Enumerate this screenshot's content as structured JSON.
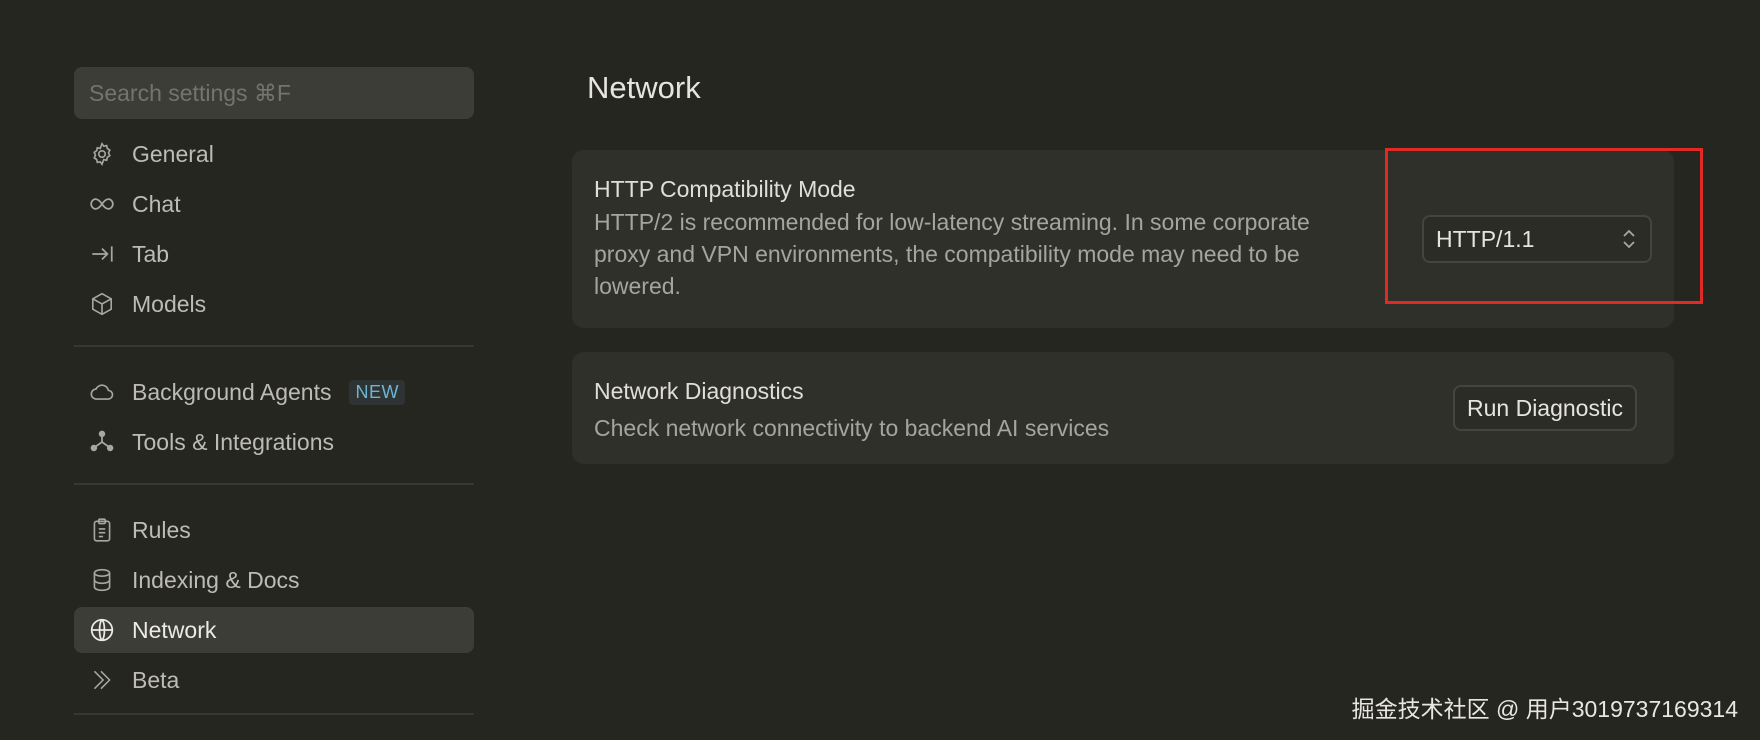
{
  "search": {
    "placeholder": "Search settings ⌘F"
  },
  "sidebar": {
    "groups": [
      [
        {
          "label": "General",
          "icon": "gear-icon"
        },
        {
          "label": "Chat",
          "icon": "infinity-icon"
        },
        {
          "label": "Tab",
          "icon": "arrow-right-bar-icon"
        },
        {
          "label": "Models",
          "icon": "cube-icon"
        }
      ],
      [
        {
          "label": "Background Agents",
          "icon": "cloud-icon",
          "badge": "NEW"
        },
        {
          "label": "Tools & Integrations",
          "icon": "nodes-icon"
        }
      ],
      [
        {
          "label": "Rules",
          "icon": "clipboard-icon"
        },
        {
          "label": "Indexing & Docs",
          "icon": "database-icon"
        },
        {
          "label": "Network",
          "icon": "globe-icon",
          "active": true
        },
        {
          "label": "Beta",
          "icon": "double-chevron-icon"
        }
      ]
    ]
  },
  "main": {
    "title": "Network",
    "http_mode": {
      "title": "HTTP Compatibility Mode",
      "description": "HTTP/2 is recommended for low-latency streaming. In some corporate proxy and VPN environments, the compatibility mode may need to be lowered.",
      "selected": "HTTP/1.1"
    },
    "diagnostics": {
      "title": "Network Diagnostics",
      "description": "Check network connectivity to backend AI services",
      "button_label": "Run Diagnostic"
    }
  },
  "watermark": "掘金技术社区 @ 用户3019737169314",
  "colors": {
    "background": "#262621",
    "card": "#30302b",
    "highlight": "#e22a24",
    "badge": "#6fb5d3"
  }
}
